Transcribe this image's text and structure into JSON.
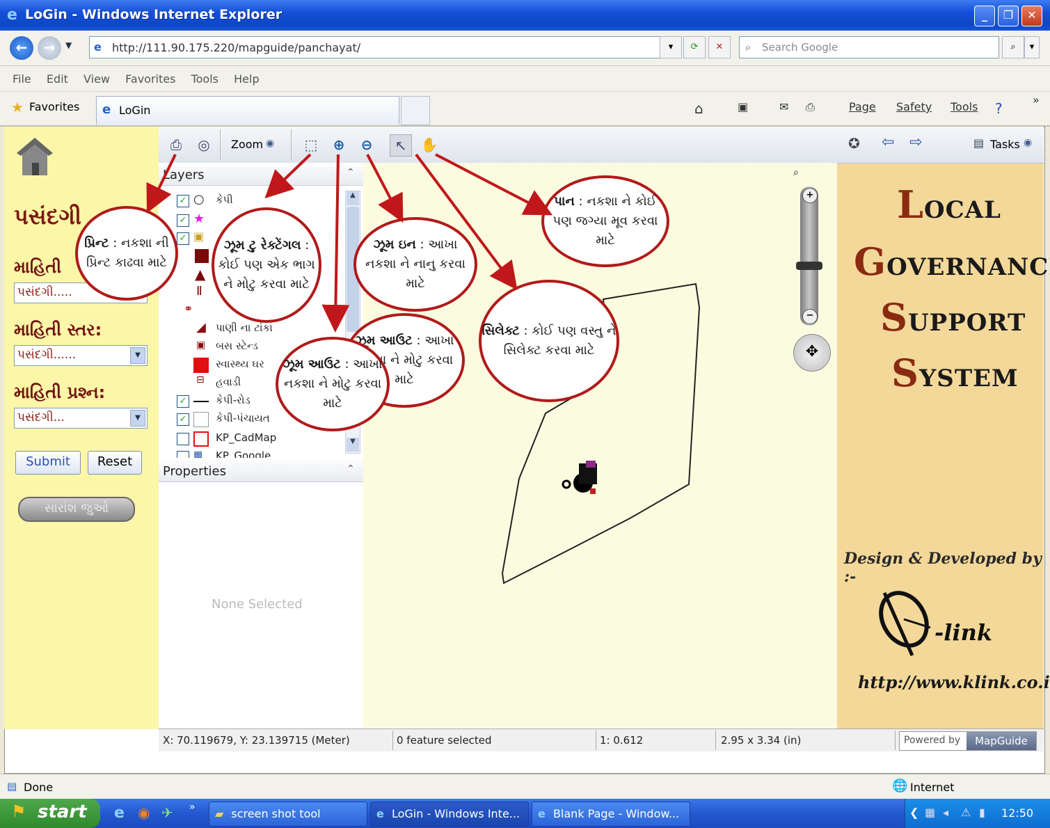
{
  "window": {
    "title": "LoGin - Windows Internet Explorer"
  },
  "address": {
    "url": "http://111.90.175.220/mapguide/panchayat/",
    "search_placeholder": "Search Google"
  },
  "menu": [
    "File",
    "Edit",
    "View",
    "Favorites",
    "Tools",
    "Help"
  ],
  "favbar": {
    "favorites_label": "Favorites",
    "tab_title": "LoGin"
  },
  "commandbar": {
    "page": "Page",
    "safety": "Safety",
    "tools": "Tools"
  },
  "left_panel": {
    "heading": "પસંદગી",
    "label1": "માહિતી",
    "select1": "પસંદગી.....",
    "label2": "માહિતી સ્તર:",
    "select2": "પસંદગી......",
    "label3": "માહિતી પ્રશ્ન:",
    "select3": "પસંદગી...",
    "submit": "Submit",
    "reset": "Reset",
    "summary_button": "સારાંશ જુઓ"
  },
  "toolbar": {
    "zoom_label": "Zoom",
    "tasks_label": "Tasks"
  },
  "layers": {
    "title": "Layers",
    "items": [
      {
        "label": "કેપી",
        "checked": true
      },
      {
        "label": "",
        "checked": true
      },
      {
        "label": "",
        "checked": true
      },
      {
        "label": "",
        "checked": false
      },
      {
        "label": "",
        "checked": false
      },
      {
        "label": "",
        "checked": false
      },
      {
        "label": "",
        "checked": false
      },
      {
        "label": "પાણી ના ટાંકા",
        "checked": false
      },
      {
        "label": "બસ સ્ટેન્ડ",
        "checked": false
      },
      {
        "label": "સ્વાસ્થ્ય ઘર",
        "checked": false
      },
      {
        "label": "હવાડી",
        "checked": false
      },
      {
        "label": "કેપી-રોડ",
        "checked": true
      },
      {
        "label": "કેપી-પંચાયત",
        "checked": true
      },
      {
        "label": "KP_CadMap",
        "checked": false
      },
      {
        "label": "KP_Google",
        "checked": false
      }
    ]
  },
  "properties": {
    "title": "Properties",
    "empty_text": "None Selected"
  },
  "callouts": {
    "print": {
      "title": "પ્રિન્ટ",
      "text": ": નકશા ની પ્રિન્ટ કાઢવા માટે"
    },
    "zoom_rect": {
      "title": "ઝૂમ ટુ રેક્ટેંગલ",
      "text": ": કોઈ પણ એક ભાગ ને મોટુ કરવા માટે"
    },
    "zoom_in": {
      "title": "ઝૂમ ઇન",
      "text": ": આખા નકશા ને નાનુ કરવા માટે"
    },
    "pan": {
      "title": "પાન",
      "text": ": નકશા ને કોઈ પણ જગ્યા મૂવ કરવા માટે"
    },
    "select": {
      "title": "સિલેક્ટ",
      "text": ": કોઈ પણ વસ્તુ ને સિલેક્ટ કરવા માટે"
    },
    "zoom_out": {
      "title": "ઝૂમ આઉટ",
      "text": ": આખા નકશા ને મોટુ કરવા માટે"
    }
  },
  "brand": {
    "line1": "OCAL",
    "line2": "OVERNANCE",
    "line3": "UPPORT",
    "line4": "YSTEM",
    "credit": "Design & Developed by :-",
    "company": "-link",
    "url": "http://www.klink.co.in"
  },
  "map_status": {
    "coords": "X: 70.119679, Y: 23.139715 (Meter)",
    "features": "0 feature selected",
    "scale": "1: 0.612",
    "size": "2.95 x 3.34 (in)",
    "powered_by": "Powered by",
    "mapguide": "MapGuide"
  },
  "ie_status": {
    "left": "Done",
    "zone": "Internet"
  },
  "taskbar": {
    "start": "start",
    "tasks": [
      "screen shot tool",
      "LoGin - Windows Inte...",
      "Blank Page - Window..."
    ],
    "clock": "12:50"
  }
}
